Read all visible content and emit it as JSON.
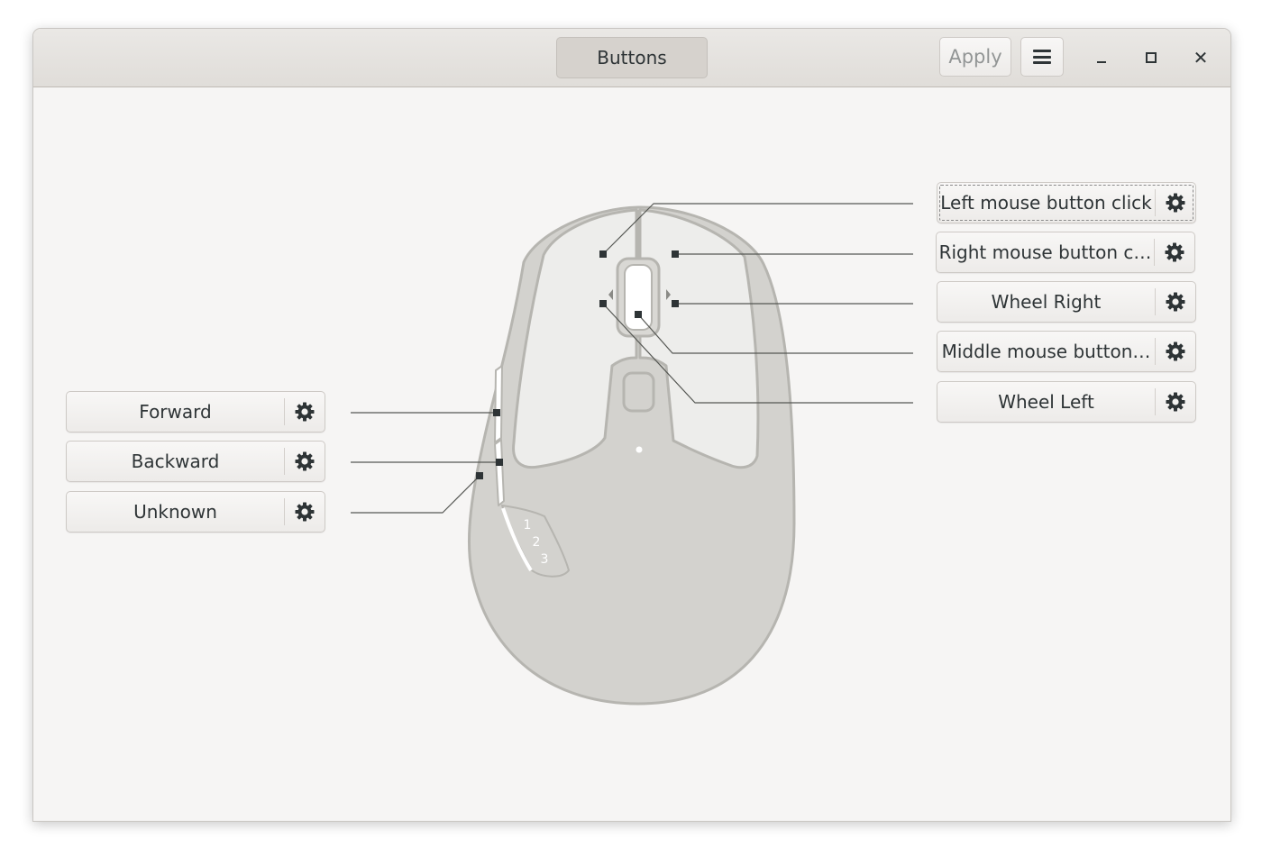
{
  "window": {
    "title": "Buttons",
    "apply_label": "Apply",
    "menu_icon": "hamburger-menu-icon",
    "controls": [
      "minimize-icon",
      "maximize-icon",
      "close-icon"
    ],
    "close_glyph": "✕"
  },
  "left_buttons": [
    {
      "label": "Forward",
      "icon": "gear-icon"
    },
    {
      "label": "Backward",
      "icon": "gear-icon"
    },
    {
      "label": "Unknown",
      "icon": "gear-icon"
    }
  ],
  "right_buttons": [
    {
      "label": "Left mouse button click",
      "icon": "gear-icon",
      "focused": true
    },
    {
      "label": "Right mouse button c…",
      "icon": "gear-icon"
    },
    {
      "label": "Wheel Right",
      "icon": "gear-icon"
    },
    {
      "label": "Middle mouse button…",
      "icon": "gear-icon"
    },
    {
      "label": "Wheel Left",
      "icon": "gear-icon"
    }
  ],
  "mouse": {
    "thumb_labels": [
      "1",
      "2",
      "3"
    ]
  },
  "colors": {
    "window_bg": "#f6f5f4",
    "header_bg": "#e0ddd9",
    "mouse_body": "#d3d2ce",
    "mouse_outline": "#b6b5b0",
    "mouse_top": "#ededeb",
    "text": "#2e3436",
    "disabled_text": "#929595"
  }
}
